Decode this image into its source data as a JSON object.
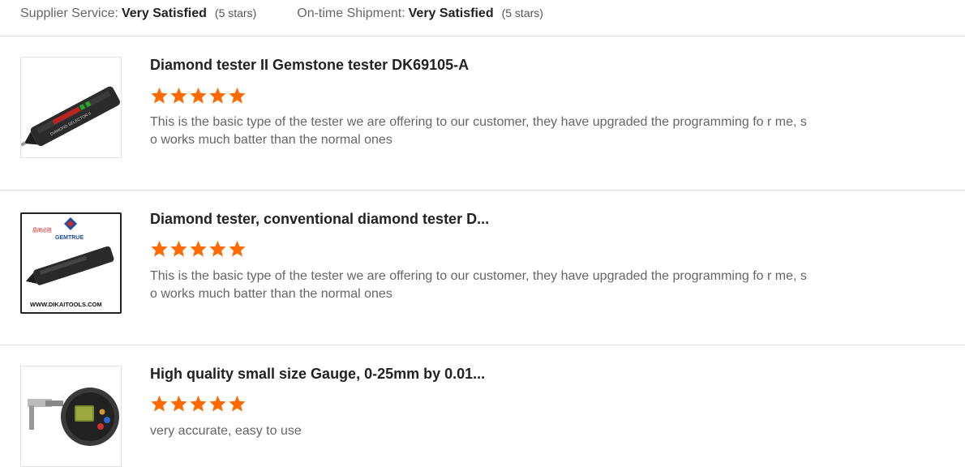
{
  "summary": {
    "supplier_service_label": "Supplier Service:",
    "supplier_service_value": "Very Satisfied",
    "supplier_service_stars": "(5 stars)",
    "shipment_label": "On-time Shipment:",
    "shipment_value": "Very Satisfied",
    "shipment_stars": "(5 stars)"
  },
  "colors": {
    "star": "#ff6a00",
    "divider": "#dddddd"
  },
  "reviews": [
    {
      "title": "Diamond tester II Gemstone tester DK69105-A",
      "rating": 5,
      "comment": "This is the basic type of the tester we are offering to our customer, they have upgraded the programming fo r me, so works much batter than the normal ones"
    },
    {
      "title": "Diamond tester, conventional diamond tester D...",
      "rating": 5,
      "comment": "This is the basic type of the tester we are offering to our customer, they have upgraded the programming fo r me, so works much batter than the normal ones",
      "image_text": {
        "brand": "GEMTRUE",
        "cn": "晶阁必胜",
        "url": "WWW.DIKAITOOLS.COM"
      }
    },
    {
      "title": "High quality small size Gauge, 0-25mm by 0.01...",
      "rating": 5,
      "comment": "very accurate, easy to use"
    }
  ]
}
